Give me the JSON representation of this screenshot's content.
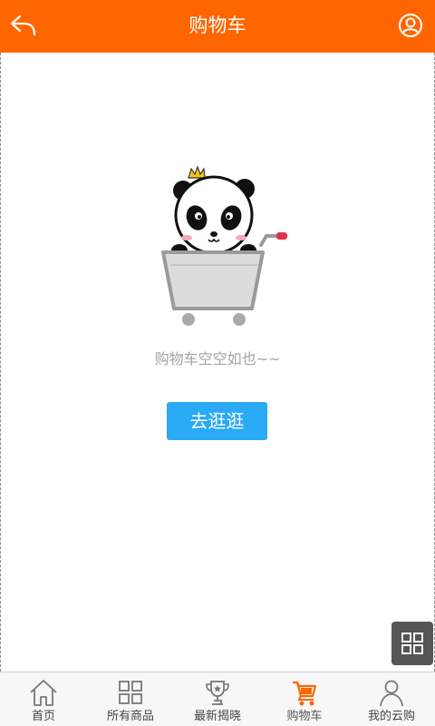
{
  "header": {
    "title": "购物车",
    "back_icon": "back-arrow-icon",
    "user_icon": "user-circle-icon"
  },
  "empty_state": {
    "image": "panda-in-cart-illustration",
    "message": "购物车空空如也~~",
    "button_label": "去逛逛"
  },
  "floating_button": {
    "icon": "grid-icon"
  },
  "tabbar": {
    "items": [
      {
        "label": "首页",
        "icon": "home-icon"
      },
      {
        "label": "所有商品",
        "icon": "grid-squares-icon"
      },
      {
        "label": "最新揭晓",
        "icon": "trophy-icon"
      },
      {
        "label": "购物车",
        "icon": "cart-icon",
        "active": true
      },
      {
        "label": "我的云购",
        "icon": "person-icon"
      }
    ]
  },
  "colors": {
    "header_bg": "#ff6600",
    "button_bg": "#2aa9f5",
    "active_tab_icon": "#ff6600"
  }
}
